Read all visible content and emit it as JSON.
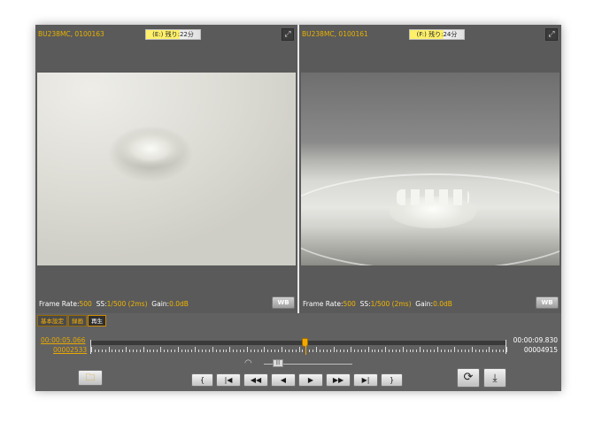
{
  "panels": [
    {
      "camera_id": "BU238MC, 0100163",
      "remaining": "(E:) 残り:22分",
      "frame_rate_label": "Frame Rate:",
      "frame_rate_value": "500",
      "ss_label": "SS:",
      "ss_value": "1/500  (2ms)",
      "gain_label": "Gain:",
      "gain_value": "0.0dB",
      "wb_label": "WB",
      "expand_icon": "expand-icon"
    },
    {
      "camera_id": "BU238MC, 0100161",
      "remaining": "(F:) 残り:24分",
      "frame_rate_label": "Frame Rate:",
      "frame_rate_value": "500",
      "ss_label": "SS:",
      "ss_value": "1/500  (2ms)",
      "gain_label": "Gain:",
      "gain_value": "0.0dB",
      "wb_label": "WB",
      "expand_icon": "expand-icon"
    }
  ],
  "tabs": [
    {
      "label": "基本設定",
      "active": false
    },
    {
      "label": "録画",
      "active": false
    },
    {
      "label": "再生",
      "active": true
    }
  ],
  "timeline": {
    "start_time": "00:00:05.066",
    "start_frame": "00002533",
    "end_time": "00:00:09.830",
    "end_frame": "00004915",
    "playhead_fraction": 0.515
  },
  "speed": {
    "thumb_label": "|||",
    "gauge_icon": "speed-gauge-icon"
  },
  "transport": {
    "mark_in": "{",
    "to_start": "|◀",
    "rewind": "◀◀",
    "step_back": "◀",
    "play": "▶",
    "fast_forward": "▶▶",
    "to_end": "▶|",
    "mark_out": "}"
  },
  "icons": {
    "folder": "folder-icon",
    "loop": "loop-icon",
    "download": "download-icon"
  },
  "colors": {
    "accent": "#f0b400",
    "background": "#616161"
  }
}
